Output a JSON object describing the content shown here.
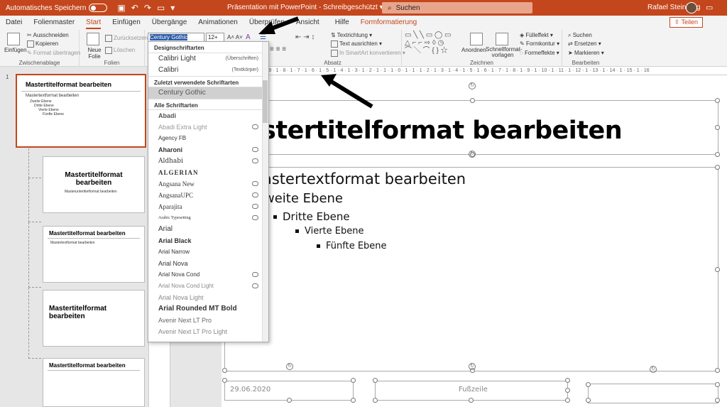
{
  "titlebar": {
    "autosave_label": "Automatisches Speichern",
    "doc_title": "Präsentation mit PowerPoint  -  Schreibgeschützt  ▾",
    "search_placeholder": "Suchen",
    "user_name": "Rafael Steinberg"
  },
  "tabs": [
    "Datei",
    "Folienmaster",
    "Start",
    "Einfügen",
    "Übergänge",
    "Animationen",
    "Überprüfen",
    "Ansicht",
    "Hilfe",
    "Formformatierung"
  ],
  "share_label": "Teilen",
  "ribbon": {
    "clipboard": {
      "paste": "Einfügen",
      "cut": "Ausschneiden",
      "copy": "Kopieren",
      "format_painter": "Format übertragen",
      "label": "Zwischenablage"
    },
    "slides": {
      "new_slide": "Neue Folie",
      "reset": "Zurücksetzen",
      "delete": "Löschen",
      "label": "Folien"
    },
    "font": {
      "font_name": "Century Gothic",
      "font_size": "12+"
    },
    "paragraph": {
      "text_direction": "Textrichtung",
      "align_text": "Text ausrichten",
      "smartart": "In SmartArt konvertieren",
      "label": "Absatz"
    },
    "drawing": {
      "arrange": "Anordnen",
      "quick_styles": "Schnellformat-vorlagen",
      "fill": "Fülleffekt",
      "outline": "Formkontur",
      "effects": "Formeffekte",
      "label": "Zeichnen"
    },
    "editing": {
      "find": "Suchen",
      "replace": "Ersetzen",
      "select": "Markieren",
      "label": "Bearbeiten"
    }
  },
  "ruler_text": "16 · 1 · 15 · 1 · 14 · 1 · 13 · 1 · 12 · 1 · 11 · 1 · 10 · 1 · 9 · 1 · 8 · 1 · 7 · 1 · 6 · 1 · 5 · 1 · 4 · 1 · 3 · 1 · 2 · 1 · 1 · 1 · 0 · 1 · 1 · 1 · 2 · 1 · 3 · 1 · 4 · 1 · 5 · 1 · 6 · 1 · 7 · 1 · 8 · 1 · 9 · 1 · 10 · 1 · 11 · 1 · 12 · 1 · 13 · 1 · 14 · 1 · 15 · 1 · 16",
  "font_dropdown": {
    "heading_fonts_label": "Designschriftarten",
    "theme_fonts": [
      {
        "name": "Calibri Light",
        "role": "(Überschriften)"
      },
      {
        "name": "Calibri",
        "role": "(Textkörper)"
      }
    ],
    "recent_label": "Zuletzt verwendete Schriftarten",
    "recent": [
      "Century Gothic"
    ],
    "all_label": "Alle Schriftarten",
    "all_fonts": [
      "Abadi",
      "Abadi Extra Light",
      "Agency FB",
      "Aharoni",
      "Aldhabi",
      "ALGERIAN",
      "Angsana New",
      "AngsanaUPC",
      "Aparajita",
      "Arabic Typesetting",
      "Arial",
      "Arial Black",
      "Arial Narrow",
      "Arial Nova",
      "Arial Nova Cond",
      "Arial Nova Cond Light",
      "Arial Nova Light",
      "Arial Rounded MT Bold",
      "Avenir Next LT Pro",
      "Avenir Next LT Pro Light"
    ]
  },
  "thumbnails": {
    "slide_number": "1",
    "master_title": "Mastertitelformat bearbeiten",
    "master_text": "Mastertextformat bearbeiten",
    "levels": [
      "Zweite Ebene",
      "Dritte Ebene",
      "Vierte Ebene",
      "Fünfte Ebene"
    ],
    "layout_title_2": "Mastertitelformat bearbeiten",
    "layout_sub_2": "Masteruntertitelformat bearbeiten",
    "layout_title_3": "Mastertitelformat bearbeiten",
    "layout_title_4": "Mastertitelformat bearbeiten",
    "layout_title_5": "Mastertitelformat bearbeiten"
  },
  "slide": {
    "title": "stertitelformat bearbeiten",
    "level1": "astertextformat bearbeiten",
    "level2": "weite Ebene",
    "level3": "Dritte Ebene",
    "level4": "Vierte Ebene",
    "level5": "Fünfte Ebene",
    "date": "29.06.2020",
    "footer": "Fußzeile"
  },
  "colors": {
    "accent": "#c4461c",
    "ribbon_bg": "#f3f3f3"
  }
}
